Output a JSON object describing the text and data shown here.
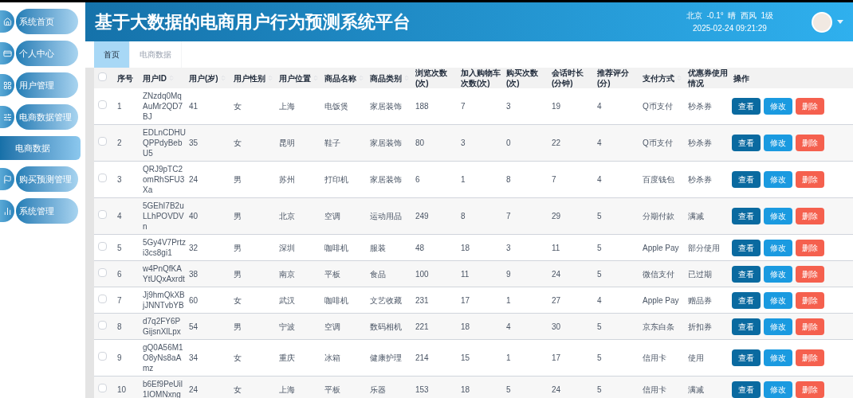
{
  "sidebar": {
    "items": [
      {
        "label": "系统首页",
        "selected": false
      },
      {
        "label": "个人中心",
        "selected": false
      },
      {
        "label": "用户管理",
        "selected": false
      },
      {
        "label": "电商数据管理",
        "selected": false,
        "children": [
          {
            "label": "电商数据",
            "selected": true
          }
        ]
      },
      {
        "label": "购买预测管理",
        "selected": false
      },
      {
        "label": "系统管理",
        "selected": false
      }
    ]
  },
  "header": {
    "title": "基于大数据的电商用户行为预测系统平台",
    "weather": "北京  -0.1°  晴  西风  1级",
    "datetime": "2025-02-24 09:21:29"
  },
  "tabs": [
    {
      "label": "首页",
      "selected": true
    },
    {
      "label": "电商数据",
      "selected": false
    }
  ],
  "table": {
    "select_all": {
      "checked": false
    },
    "columns": [
      {
        "label": "序号",
        "sortable": false
      },
      {
        "label": "用户ID",
        "sortable": true
      },
      {
        "label": "用户(岁)",
        "sortable": true
      },
      {
        "label": "用户性别",
        "sortable": true
      },
      {
        "label": "用户位置",
        "sortable": true
      },
      {
        "label": "商品名称",
        "sortable": true
      },
      {
        "label": "商品类别",
        "sortable": true
      },
      {
        "label": "浏览次数(次)",
        "sortable": false
      },
      {
        "label": "加入购物车次数(次)",
        "sortable": false
      },
      {
        "label": "购买次数(次)",
        "sortable": false
      },
      {
        "label": "会话时长(分钟)",
        "sortable": false
      },
      {
        "label": "推荐评分(分)",
        "sortable": false
      },
      {
        "label": "支付方式",
        "sortable": true
      },
      {
        "label": "优惠券使用情况",
        "sortable": false
      },
      {
        "label": "操作",
        "sortable": false
      }
    ],
    "rows": [
      {
        "checked": false,
        "cells": [
          "1",
          "ZNzdq0MqAuMr2QD7BJ",
          "41",
          "女",
          "上海",
          "电饭煲",
          "家居装饰",
          "188",
          "7",
          "3",
          "19",
          "4",
          "Q币支付",
          "秒杀券"
        ],
        "actions": [
          {
            "label": "查看",
            "kind": "view"
          },
          {
            "label": "修改",
            "kind": "edit"
          },
          {
            "label": "删除",
            "kind": "delete"
          }
        ]
      },
      {
        "checked": false,
        "cells": [
          "2",
          "EDLnCDHUQPPdyBebU5",
          "35",
          "女",
          "昆明",
          "鞋子",
          "家居装饰",
          "80",
          "3",
          "0",
          "22",
          "4",
          "Q币支付",
          "秒杀券"
        ],
        "actions": [
          {
            "label": "查看",
            "kind": "view"
          },
          {
            "label": "修改",
            "kind": "edit"
          },
          {
            "label": "删除",
            "kind": "delete"
          }
        ]
      },
      {
        "checked": false,
        "cells": [
          "3",
          "QRJ9pTC2omRhSFU3Xa",
          "24",
          "男",
          "苏州",
          "打印机",
          "家居装饰",
          "6",
          "1",
          "8",
          "7",
          "4",
          "百度钱包",
          "秒杀券"
        ],
        "actions": [
          {
            "label": "查看",
            "kind": "view"
          },
          {
            "label": "修改",
            "kind": "edit"
          },
          {
            "label": "删除",
            "kind": "delete"
          }
        ]
      },
      {
        "checked": false,
        "cells": [
          "4",
          "5GEhI7B2uLLhPOVDVn",
          "40",
          "男",
          "北京",
          "空调",
          "运动用品",
          "249",
          "8",
          "7",
          "29",
          "5",
          "分期付款",
          "满减"
        ],
        "actions": [
          {
            "label": "查看",
            "kind": "view"
          },
          {
            "label": "修改",
            "kind": "edit"
          },
          {
            "label": "删除",
            "kind": "delete"
          }
        ]
      },
      {
        "checked": false,
        "cells": [
          "5",
          "5Gy4V7Prtzi3cs8gi1",
          "32",
          "男",
          "深圳",
          "咖啡机",
          "服装",
          "48",
          "18",
          "3",
          "11",
          "5",
          "Apple Pay",
          "部分使用"
        ],
        "actions": [
          {
            "label": "查看",
            "kind": "view"
          },
          {
            "label": "修改",
            "kind": "edit"
          },
          {
            "label": "删除",
            "kind": "delete"
          }
        ]
      },
      {
        "checked": false,
        "cells": [
          "6",
          "w4PnQfKAYtUQxAxrdt",
          "38",
          "男",
          "南京",
          "平板",
          "食品",
          "100",
          "11",
          "9",
          "24",
          "5",
          "微信支付",
          "已过期"
        ],
        "actions": [
          {
            "label": "查看",
            "kind": "view"
          },
          {
            "label": "修改",
            "kind": "edit"
          },
          {
            "label": "删除",
            "kind": "delete"
          }
        ]
      },
      {
        "checked": false,
        "cells": [
          "7",
          "Jj9hmQkXBjJNNTvbYB",
          "60",
          "女",
          "武汉",
          "咖啡机",
          "文艺收藏",
          "231",
          "17",
          "1",
          "27",
          "4",
          "Apple Pay",
          "赠品券"
        ],
        "actions": [
          {
            "label": "查看",
            "kind": "view"
          },
          {
            "label": "修改",
            "kind": "edit"
          },
          {
            "label": "删除",
            "kind": "delete"
          }
        ]
      },
      {
        "checked": false,
        "cells": [
          "8",
          "d7q2FY6PGijsnXlLpx",
          "54",
          "男",
          "宁波",
          "空调",
          "数码相机",
          "221",
          "18",
          "4",
          "30",
          "5",
          "京东白条",
          "折扣券"
        ],
        "actions": [
          {
            "label": "查看",
            "kind": "view"
          },
          {
            "label": "修改",
            "kind": "edit"
          },
          {
            "label": "删除",
            "kind": "delete"
          }
        ]
      },
      {
        "checked": false,
        "cells": [
          "9",
          "gQ0A56M1O8yNs8aAmz",
          "34",
          "女",
          "重庆",
          "冰箱",
          "健康护理",
          "214",
          "15",
          "1",
          "17",
          "5",
          "信用卡",
          "使用"
        ],
        "actions": [
          {
            "label": "查看",
            "kind": "view"
          },
          {
            "label": "修改",
            "kind": "edit"
          },
          {
            "label": "删除",
            "kind": "delete"
          }
        ]
      },
      {
        "checked": false,
        "cells": [
          "10",
          "b6Ef9PeUil1IOMNxng",
          "24",
          "女",
          "上海",
          "平板",
          "乐器",
          "153",
          "18",
          "5",
          "24",
          "5",
          "信用卡",
          "满减"
        ],
        "actions": [
          {
            "label": "查看",
            "kind": "view"
          },
          {
            "label": "修改",
            "kind": "edit"
          },
          {
            "label": "删除",
            "kind": "delete"
          }
        ]
      }
    ]
  }
}
